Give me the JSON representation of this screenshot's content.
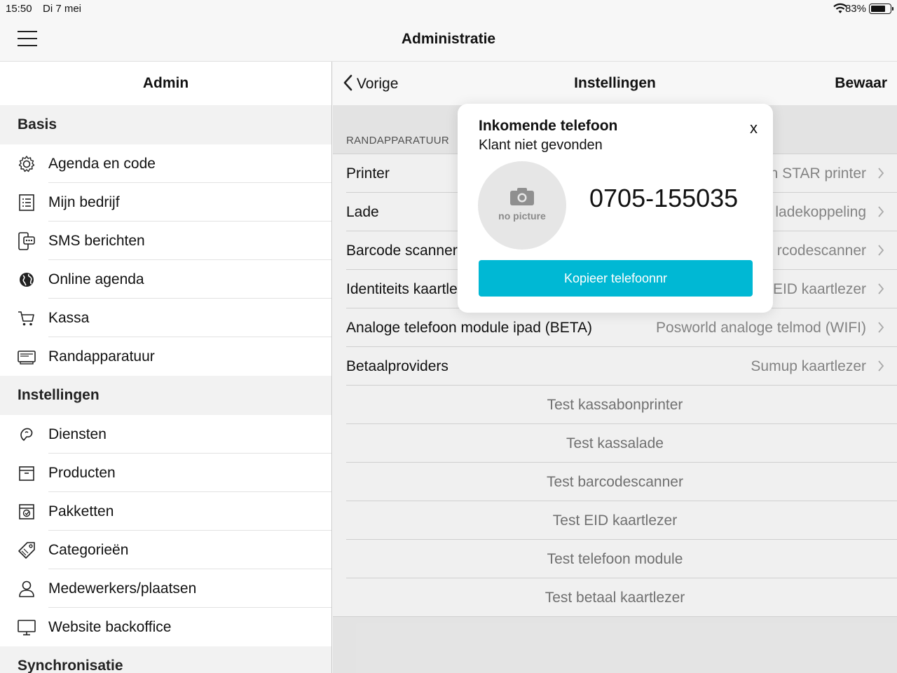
{
  "status": {
    "time": "15:50",
    "date": "Di 7 mei",
    "battery_text": "83%",
    "battery_level": 0.83
  },
  "topnav": {
    "title": "Administratie"
  },
  "left": {
    "header": "Admin",
    "sections": [
      {
        "title": "Basis",
        "items": [
          {
            "label": "Agenda en code",
            "icon": "gear-icon"
          },
          {
            "label": "Mijn bedrijf",
            "icon": "list-icon"
          },
          {
            "label": "SMS berichten",
            "icon": "sms-icon"
          },
          {
            "label": "Online agenda",
            "icon": "globe-icon"
          },
          {
            "label": "Kassa",
            "icon": "cart-icon"
          },
          {
            "label": "Randapparatuur",
            "icon": "devices-icon"
          }
        ]
      },
      {
        "title": "Instellingen",
        "items": [
          {
            "label": "Diensten",
            "icon": "service-icon"
          },
          {
            "label": "Producten",
            "icon": "box-icon"
          },
          {
            "label": "Pakketten",
            "icon": "package-icon"
          },
          {
            "label": "Categorieën",
            "icon": "tag-icon"
          },
          {
            "label": "Medewerkers/plaatsen",
            "icon": "person-icon"
          },
          {
            "label": "Website backoffice",
            "icon": "monitor-icon"
          }
        ]
      },
      {
        "title": "Synchronisatie",
        "items": []
      }
    ]
  },
  "right": {
    "back": "Vorige",
    "title": "Instellingen",
    "save": "Bewaar",
    "group_caption": "RANDAPPARATUUR",
    "rows": [
      {
        "label": "Printer",
        "value": "n STAR printer"
      },
      {
        "label": "Lade",
        "value": "ladekoppeling"
      },
      {
        "label": "Barcode scanner",
        "value": "rcodescanner"
      },
      {
        "label": "Identiteits kaartle",
        "value": "EID kaartlezer"
      },
      {
        "label": "Analoge telefoon module ipad (BETA)",
        "value": "Posworld analoge telmod (WIFI)"
      },
      {
        "label": "Betaalproviders",
        "value": "Sumup kaartlezer"
      }
    ],
    "buttons": [
      "Test kassabonprinter",
      "Test kassalade",
      "Test barcodescanner",
      "Test EID kaartlezer",
      "Test telefoon module",
      "Test betaal kaartlezer"
    ]
  },
  "popup": {
    "title": "Inkomende telefoon",
    "subtitle": "Klant niet gevonden",
    "close": "x",
    "avatar_text": "no picture",
    "phone": "0705-155035",
    "button": "Kopieer telefoonnr",
    "button_color": "#00b8d4"
  }
}
